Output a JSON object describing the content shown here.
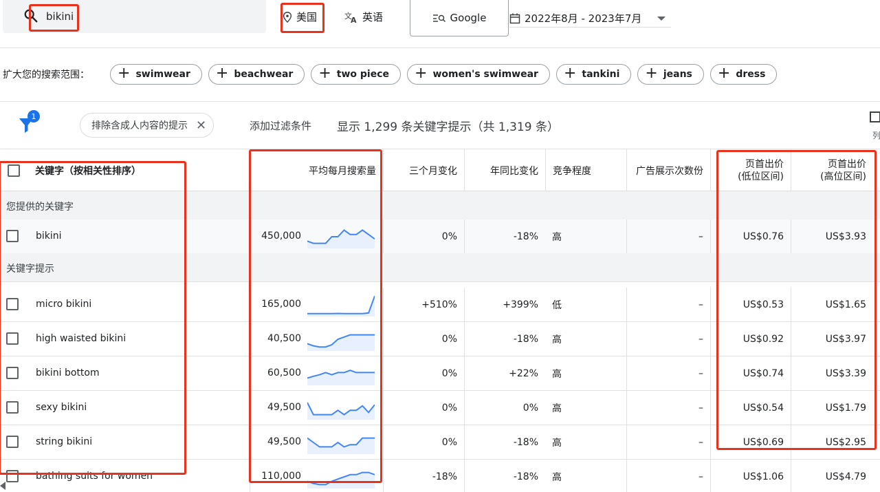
{
  "search": {
    "query": "bikini"
  },
  "location": {
    "label": "美国"
  },
  "language": {
    "label": "英语"
  },
  "network": {
    "label": "Google"
  },
  "date_range": {
    "label": "2022年8月 - 2023年7月"
  },
  "broaden": {
    "label": "扩大您的搜索范围：",
    "chips": [
      "swimwear",
      "beachwear",
      "two piece",
      "women's swimwear",
      "tankini",
      "jeans",
      "dress"
    ]
  },
  "filters": {
    "badge_count": "1",
    "adult_chip": "排除含成人内容的提示",
    "add_filter": "添加过滤条件",
    "showing": "显示 1,299 条关键字提示（共 1,319 条）",
    "columns_label": "列"
  },
  "table": {
    "headers": {
      "keyword": "关键字（按相关性排序）",
      "avg_monthly": "平均每月搜索量",
      "three_month": "三个月变化",
      "yoy": "年同比变化",
      "competition": "竞争程度",
      "impression_share": "广告展示次数份",
      "bid_low_1": "页首出价",
      "bid_low_2": "(低位区间)",
      "bid_high_1": "页首出价",
      "bid_high_2": "(高位区间)"
    },
    "group_provided": "您提供的关键字",
    "group_suggestions": "关键字提示",
    "rows": [
      {
        "keyword": "bikini",
        "volume": "450,000",
        "three_month": "0%",
        "yoy": "-18%",
        "competition": "高",
        "impression": "–",
        "bid_low": "US$0.76",
        "bid_high": "US$3.93",
        "trend": [
          3,
          2,
          2,
          2,
          5,
          5,
          8,
          6,
          6,
          8,
          6,
          4
        ]
      },
      {
        "keyword": "micro bikini",
        "volume": "165,000",
        "three_month": "+510%",
        "yoy": "+399%",
        "competition": "低",
        "impression": "–",
        "bid_low": "US$0.53",
        "bid_high": "US$1.65",
        "trend": [
          1,
          1,
          1,
          1,
          1,
          1.1,
          1,
          1,
          1,
          1,
          1.3,
          9
        ]
      },
      {
        "keyword": "high waisted bikini",
        "volume": "40,500",
        "three_month": "0%",
        "yoy": "-18%",
        "competition": "高",
        "impression": "–",
        "bid_low": "US$0.92",
        "bid_high": "US$3.97",
        "trend": [
          3,
          2,
          1.5,
          1.5,
          2.5,
          5,
          6,
          7,
          7,
          7,
          7,
          7
        ]
      },
      {
        "keyword": "bikini bottom",
        "volume": "60,500",
        "three_month": "0%",
        "yoy": "+22%",
        "competition": "高",
        "impression": "–",
        "bid_low": "US$0.74",
        "bid_high": "US$3.39",
        "trend": [
          3,
          3.8,
          4.5,
          5.5,
          4.5,
          5.5,
          5.5,
          6.5,
          5.5,
          5.5,
          5.5,
          5.5
        ]
      },
      {
        "keyword": "sexy bikini",
        "volume": "49,500",
        "three_month": "0%",
        "yoy": "0%",
        "competition": "高",
        "impression": "–",
        "bid_low": "US$0.54",
        "bid_high": "US$1.79",
        "trend": [
          7.5,
          2,
          2,
          2,
          2,
          4,
          2,
          4,
          4,
          6,
          3,
          6.5
        ]
      },
      {
        "keyword": "string bikini",
        "volume": "49,500",
        "three_month": "0%",
        "yoy": "-18%",
        "competition": "高",
        "impression": "–",
        "bid_low": "US$0.69",
        "bid_high": "US$2.95",
        "trend": [
          7,
          5,
          3,
          3,
          3,
          5,
          3,
          4,
          4,
          7,
          7,
          7
        ]
      },
      {
        "keyword": "bathing suits for women",
        "volume": "110,000",
        "three_month": "-18%",
        "yoy": "-18%",
        "competition": "高",
        "impression": "–",
        "bid_low": "US$1.06",
        "bid_high": "US$4.79",
        "trend": [
          3,
          2,
          1.5,
          1.5,
          3,
          4,
          5,
          6,
          6,
          7,
          7,
          6
        ]
      }
    ]
  }
}
